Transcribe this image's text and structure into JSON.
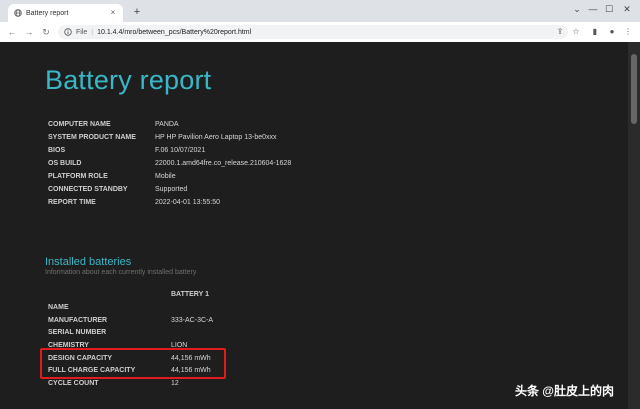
{
  "browser": {
    "tab_title": "Battery report",
    "tab_close": "×",
    "new_tab": "+",
    "window_minimize": "—",
    "window_maximize": "☐",
    "window_close": "✕",
    "nav_back": "←",
    "nav_forward": "→",
    "nav_reload": "↻",
    "address_scheme": "File",
    "address_separator": "|",
    "address_url": "10.1.4.4/mro/between_pcs/Battery%20report.html"
  },
  "report": {
    "title": "Battery report",
    "info": [
      {
        "label": "COMPUTER NAME",
        "value": "PANDA"
      },
      {
        "label": "SYSTEM PRODUCT NAME",
        "value": "HP HP Pavilion Aero Laptop 13-be0xxx"
      },
      {
        "label": "BIOS",
        "value": "F.06 10/07/2021"
      },
      {
        "label": "OS BUILD",
        "value": "22000.1.amd64fre.co_release.210604-1628"
      },
      {
        "label": "PLATFORM ROLE",
        "value": "Mobile"
      },
      {
        "label": "CONNECTED STANDBY",
        "value": "Supported"
      },
      {
        "label": "REPORT TIME",
        "value": "2022-04-01   13:55:50"
      }
    ],
    "installed_title": "Installed batteries",
    "installed_subtitle": "Information about each currently installed battery",
    "battery_column": "BATTERY 1",
    "batteries": [
      {
        "label": "NAME",
        "value": ""
      },
      {
        "label": "MANUFACTURER",
        "value": "333-AC-3C-A"
      },
      {
        "label": "SERIAL NUMBER",
        "value": ""
      },
      {
        "label": "CHEMISTRY",
        "value": "LION"
      },
      {
        "label": "DESIGN CAPACITY",
        "value": "44,156 mWh"
      },
      {
        "label": "FULL CHARGE CAPACITY",
        "value": "44,156 mWh"
      },
      {
        "label": "CYCLE COUNT",
        "value": "12"
      }
    ]
  },
  "watermark": "头条 @肚皮上的肉",
  "colors": {
    "accent": "#39b7c6",
    "highlight": "#e01c1c",
    "page_bg": "#1e1e1e"
  }
}
